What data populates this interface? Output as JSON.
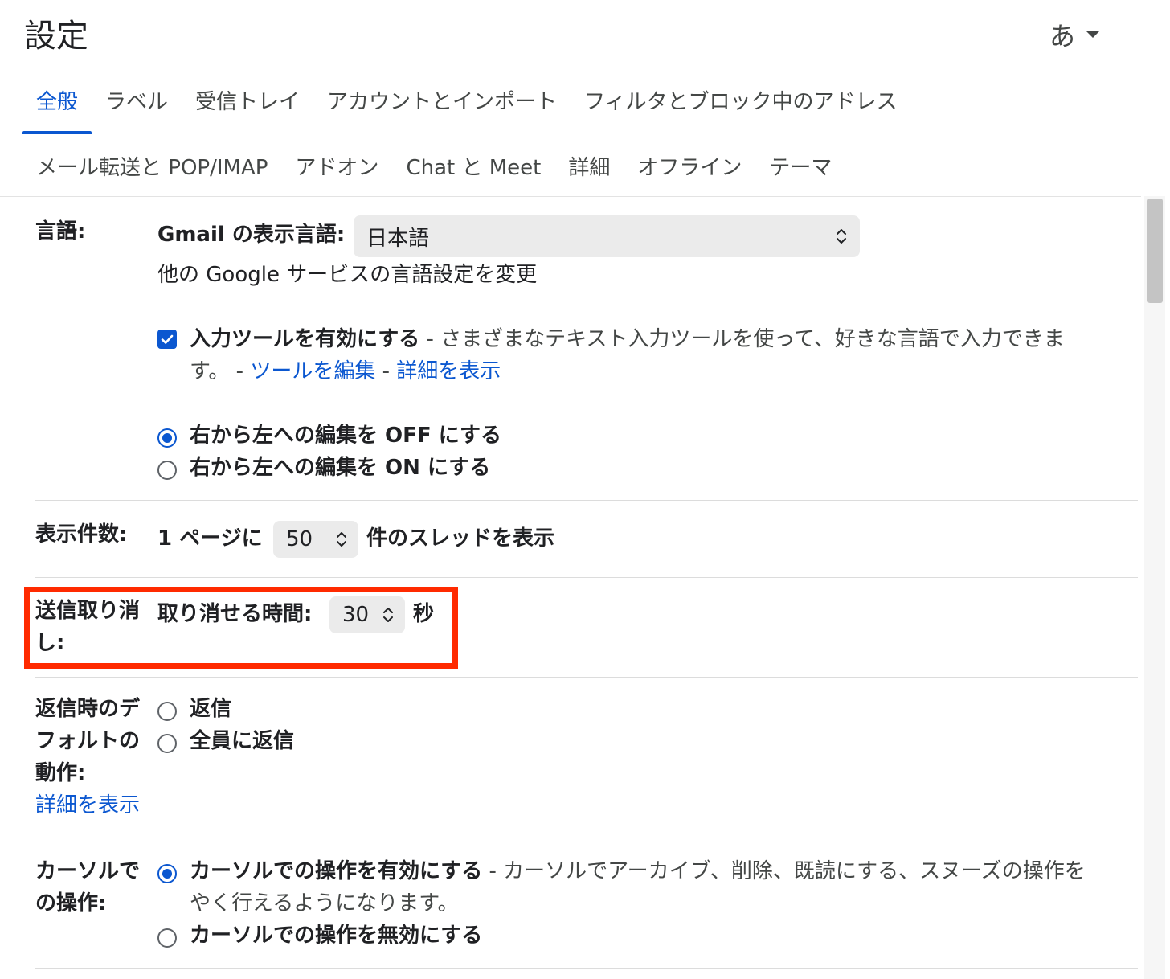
{
  "header": {
    "title": "設定",
    "ime_label": "あ"
  },
  "tabs_row1": [
    "全般",
    "ラベル",
    "受信トレイ",
    "アカウントとインポート",
    "フィルタとブロック中のアドレス"
  ],
  "tabs_row2": [
    "メール転送と POP/IMAP",
    "アドオン",
    "Chat と Meet",
    "詳細",
    "オフライン",
    "テーマ"
  ],
  "language": {
    "label": "言語:",
    "display_label": "Gmail の表示言語:",
    "selected": "日本語",
    "other_link": "他の Google サービスの言語設定を変更",
    "input_tools_bold": "入力ツールを有効にする",
    "input_tools_desc_1": " - さまざまなテキスト入力ツールを使って、好きな言語で入力できま",
    "input_tools_desc_2": "す。 - ",
    "edit_tools_link": "ツールを編集",
    "sep": " - ",
    "learn_more_link": "詳細を表示",
    "rtl_off": "右から左への編集を OFF にする",
    "rtl_on": "右から左への編集を ON にする"
  },
  "page_size": {
    "label": "表示件数:",
    "prefix": "1 ページに",
    "value": "50",
    "suffix": "件のスレッドを表示"
  },
  "undo_send": {
    "label_1": "送信取り消",
    "label_2": "し:",
    "prefix": "取り消せる時間:",
    "value": "30",
    "suffix": "秒"
  },
  "reply_default": {
    "label_1": "返信時のデ",
    "label_2": "フォルトの",
    "label_3": "動作:",
    "learn_more": "詳細を表示",
    "reply": "返信",
    "reply_all": "全員に返信"
  },
  "cursor_actions": {
    "label_1": "カーソルで",
    "label_2": "の操作:",
    "enable_bold": "カーソルでの操作を有効にする",
    "enable_desc_1": " - カーソルでアーカイブ、削除、既読にする、スヌーズの操作を",
    "enable_desc_2": "やく行えるようになります。",
    "disable": "カーソルでの操作を無効にする"
  },
  "colors": {
    "accent": "#0b57d0",
    "highlight": "#ff2a00"
  }
}
